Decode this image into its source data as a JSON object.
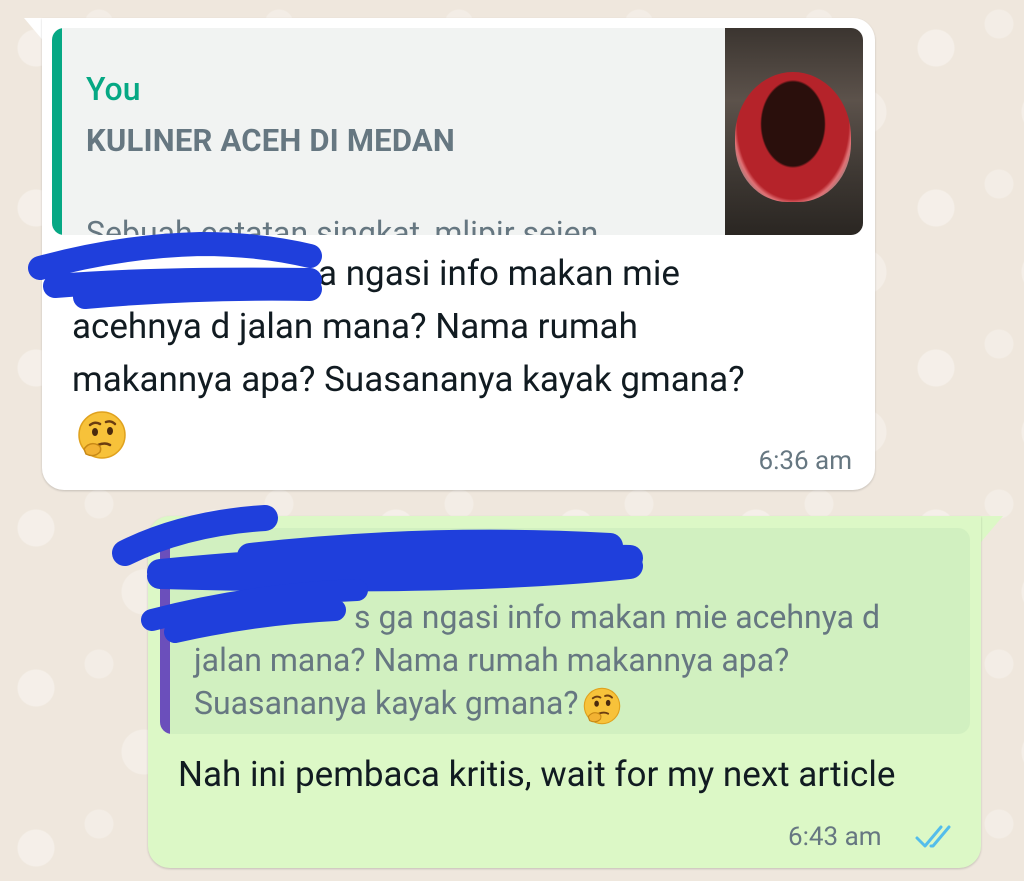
{
  "incoming": {
    "quote": {
      "author": "You",
      "title": "KULINER ACEH DI MEDAN",
      "snippet": "Sebuah catatan singkat, mlipir sejen..."
    },
    "message": "a ngasi info makan mie acehnya d jalan mana? Nama rumah makannya apa? Suasananya kayak gmana?",
    "time": "6:36 am"
  },
  "outgoing": {
    "quote": {
      "author": "",
      "text": "s ga ngasi info makan mie acehnya d jalan mana? Nama rumah makannya apa? Suasananya kayak gmana?"
    },
    "message": "Nah ini pembaca kritis, wait for my next article",
    "time": "6:43 am"
  },
  "icons": {
    "thinking_emoji": "thinking-face-icon",
    "read_receipt": "double-check-icon"
  },
  "colors": {
    "wallpaper": "#efe7dd",
    "incoming_bubble": "#ffffff",
    "outgoing_bubble": "#dcf8c6",
    "quote_bar_in": "#06a884",
    "quote_bar_out": "#6b4fbb",
    "read_tick": "#53bdeb",
    "redaction": "#1f3fdc"
  }
}
